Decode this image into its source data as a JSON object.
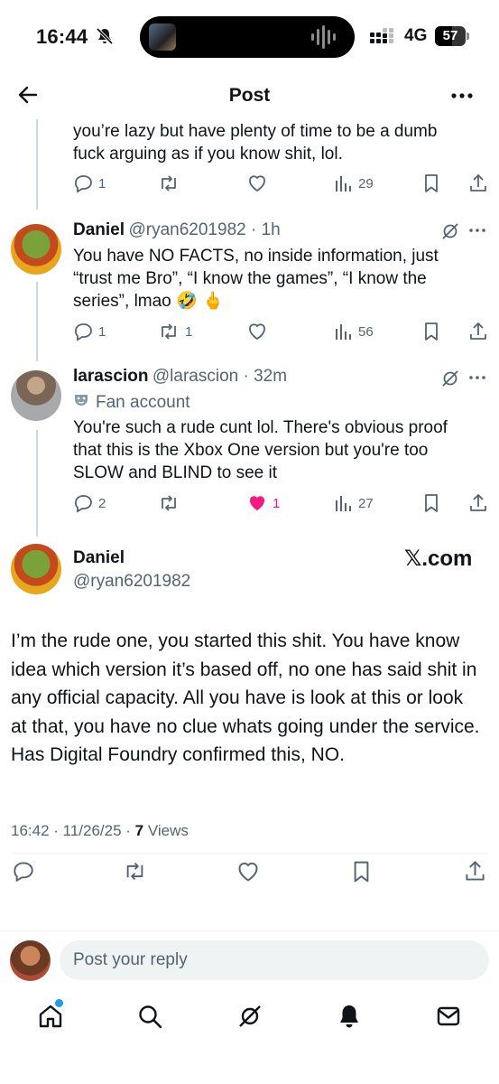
{
  "status_bar": {
    "time": "16:44",
    "network": "4G",
    "battery": "57",
    "battery_level": 0.57
  },
  "header": {
    "title": "Post"
  },
  "replies": [
    {
      "text": "you’re lazy but have plenty of time to be a dumb fuck arguing as if you know shit, lol.",
      "reply_count": "1",
      "repost_count": "",
      "like_count": "",
      "view_count": "29"
    },
    {
      "name": "Daniel",
      "handle_time": "@ryan6201982 · 1h",
      "text": "You have NO FACTS, no inside information, just “trust me Bro”, “I know the games”, “I know the series”, lmao 🤣 🖕",
      "reply_count": "1",
      "repost_count": "1",
      "like_count": "",
      "view_count": "56"
    },
    {
      "name": "larascion",
      "handle_time": "@larascion · 32m",
      "label": "Fan account",
      "text": "You're such a rude cunt lol. There's obvious proof that this is the Xbox One version but you're too SLOW and BLIND to see it",
      "reply_count": "2",
      "repost_count": "",
      "like_count": "1",
      "view_count": "27"
    }
  ],
  "main_post": {
    "name": "Daniel",
    "handle": "@ryan6201982",
    "watermark": "𝕏.com",
    "text": "I’m the rude one, you started this shit. You have know idea which version it’s based off, no one has said shit in any official capacity. All you have is look at this or look at that, you have no clue whats going under the service. Has Digital Foundry confirmed this, NO.",
    "meta_time": "16:42 · 11/26/25 · ",
    "views_count": "7",
    "views_label": " Views"
  },
  "reply_box": {
    "placeholder": "Post your reply"
  },
  "colors": {
    "accent": "#1d9bf0",
    "like": "#f91880",
    "muted": "#536471",
    "text": "#0f1419"
  },
  "icons": {
    "header": [
      "back-arrow-icon",
      "more-icon"
    ],
    "actions": [
      "reply-icon",
      "repost-icon",
      "like-icon",
      "views-icon",
      "bookmark-icon",
      "share-icon"
    ],
    "tabs": [
      "home-icon",
      "search-icon",
      "grok-icon",
      "notifications-icon",
      "messages-icon"
    ]
  }
}
